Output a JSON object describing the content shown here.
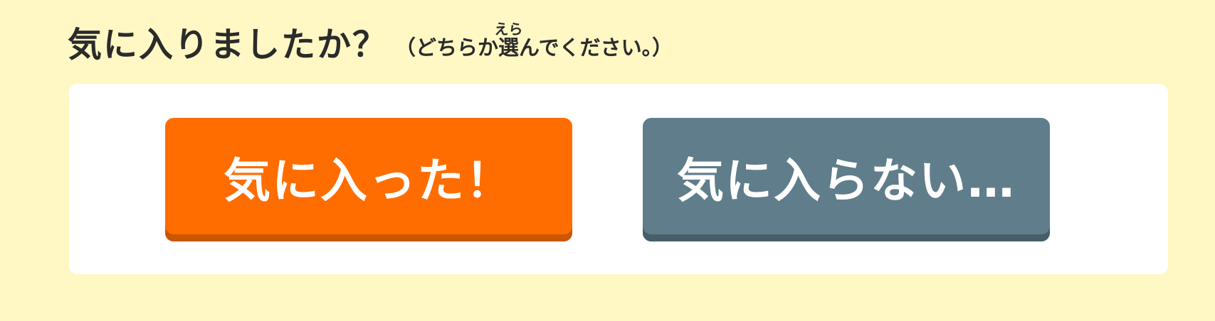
{
  "prompt": {
    "question": "気に入りましたか？",
    "hint_before": "（どちらか",
    "hint_kanji": "選",
    "hint_ruby": "えら",
    "hint_after": "んでください。）"
  },
  "choices": {
    "like_label": "気に入った！",
    "dislike_label": "気に入らない…"
  },
  "colors": {
    "background": "#fff8c4",
    "panel": "#ffffff",
    "like_button": "#ff6d00",
    "dislike_button": "#607d8b",
    "text": "#2b2b2b"
  }
}
